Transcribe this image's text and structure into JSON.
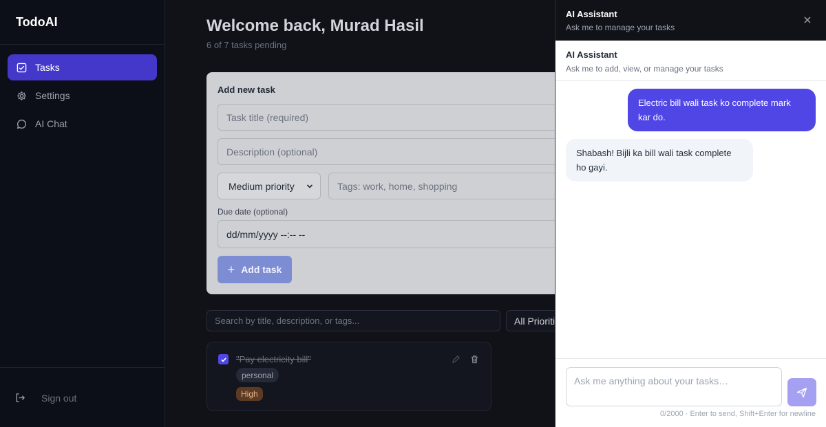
{
  "app": {
    "name": "TodoAI"
  },
  "sidebar": {
    "items": [
      {
        "label": "Tasks",
        "icon": "checkbox-icon",
        "active": true
      },
      {
        "label": "Settings",
        "icon": "gear-icon",
        "active": false
      },
      {
        "label": "AI Chat",
        "icon": "chat-bubble-icon",
        "active": false
      }
    ],
    "signout_label": "Sign out"
  },
  "main": {
    "welcome": "Welcome back, Murad Hasil",
    "pending": "6 of 7 tasks pending",
    "add_form": {
      "heading": "Add new task",
      "title_placeholder": "Task title (required)",
      "description_placeholder": "Description (optional)",
      "priority_selected": "Medium priority",
      "tags_placeholder": "Tags: work, home, shopping",
      "due_label": "Due date (optional)",
      "due_placeholder": "dd/mm/yyyy --:-- --",
      "add_label": "Add task"
    },
    "search_placeholder": "Search by title, description, or tags...",
    "priority_filter": "All Priorities",
    "tasks": [
      {
        "title": "\"Pay electricity bill\"",
        "completed": true,
        "tag": "personal",
        "priority": "High"
      }
    ]
  },
  "assistant": {
    "header_title": "AI Assistant",
    "header_subtitle": "Ask me to manage your tasks",
    "chat_title": "AI Assistant",
    "chat_subtitle": "Ask me to add, view, or manage your tasks",
    "messages": [
      {
        "role": "user",
        "text": "Electric bill wali task ko complete mark kar do."
      },
      {
        "role": "assistant",
        "text": "Shabash! Bijli ka bill wali task complete ho gayi."
      }
    ],
    "input_placeholder": "Ask me anything about your tasks…",
    "hint": "0/2000 · Enter to send, Shift+Enter for newline"
  },
  "colors": {
    "accent": "#4f46e5",
    "active_nav": "#4338ca",
    "high_badge": "#5c3a23"
  }
}
